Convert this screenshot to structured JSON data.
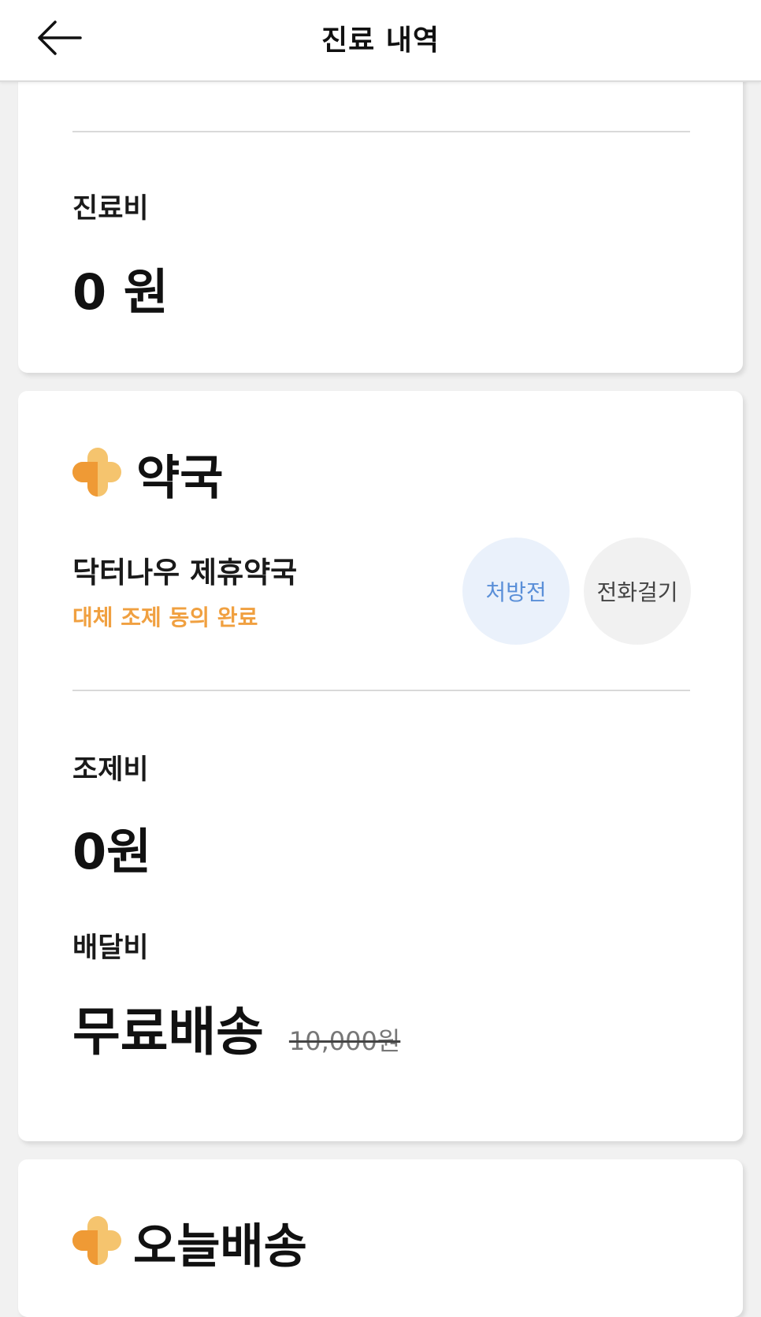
{
  "header": {
    "title": "진료 내역",
    "back_icon": "arrow-left-icon"
  },
  "treatment": {
    "fee_label": "진료비",
    "fee_value": "0 원"
  },
  "pharmacy": {
    "section_title": "약국",
    "icon": "orange-plus-icon",
    "name": "닥터나우 제휴약국",
    "status": "대체 조제 동의 완료",
    "prescription_button": "처방전",
    "call_button": "전화걸기",
    "dispensing_fee_label": "조제비",
    "dispensing_fee_value": "0원",
    "delivery_fee_label": "배달비",
    "delivery_free": "무료배송",
    "delivery_original_price": "10,000원"
  },
  "today_delivery": {
    "section_title": "오늘배송",
    "icon": "orange-plus-icon"
  },
  "colors": {
    "accent_orange": "#f0a040",
    "button_blue_text": "#5a8fd8",
    "button_blue_bg": "#eaf1fb"
  }
}
